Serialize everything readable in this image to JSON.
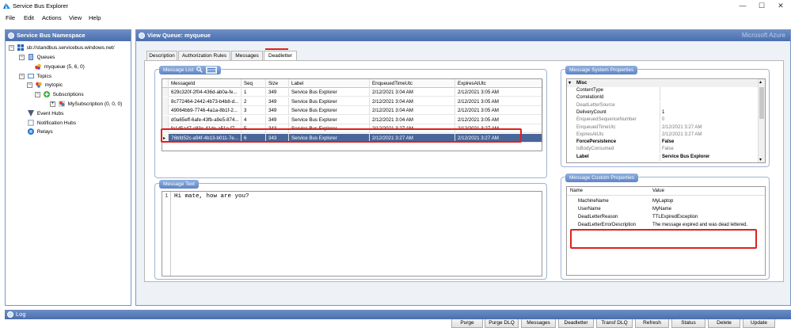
{
  "window": {
    "title": "Service Bus Explorer",
    "brand": "Microsoft Azure"
  },
  "menu": [
    "File",
    "Edit",
    "Actions",
    "View",
    "Help"
  ],
  "left": {
    "header": "Service Bus Namespace",
    "tree": {
      "root": "sb://standbus.servicebus.windows.net/",
      "queues": "Queues",
      "queue_item": "myqueue (5, 6, 0)",
      "topics": "Topics",
      "topic_item": "mytopic",
      "subscriptions": "Subscriptions",
      "subscription_item": "MySubscription (0, 0, 0)",
      "event_hubs": "Event Hubs",
      "notification_hubs": "Notification Hubs",
      "relays": "Relays"
    }
  },
  "right": {
    "header": "View Queue: myqueue",
    "tabs": [
      "Description",
      "Authorization Rules",
      "Messages",
      "Deadletter"
    ],
    "active_tab": "Deadletter",
    "message_list": {
      "title": "Message List",
      "columns": [
        "MessageId",
        "Seq",
        "Size",
        "Label",
        "EnqueuedTimeUtc",
        "ExpiresAtUtc"
      ],
      "rows": [
        [
          "629c320f-2f04-436d-ab0a-fe...",
          "1",
          "349",
          "Service Bus Explorer",
          "2/12/2021 3:04 AM",
          "2/12/2021 3:05 AM"
        ],
        [
          "8c772464-2442-4b73-b4b8-d...",
          "2",
          "349",
          "Service Bus Explorer",
          "2/12/2021 3:04 AM",
          "2/12/2021 3:05 AM"
        ],
        [
          "49064bb9-7746-4a1a-8b1f-2...",
          "3",
          "349",
          "Service Bus Explorer",
          "2/12/2021 3:04 AM",
          "2/12/2021 3:05 AM"
        ],
        [
          "d0a65eff-6afe-43fb-a9e5-874...",
          "4",
          "349",
          "Service Bus Explorer",
          "2/12/2021 3:04 AM",
          "2/12/2021 3:05 AM"
        ],
        [
          "fe145a47-c83e-41de-a51e-f7...",
          "5",
          "343",
          "Service Bus Explorer",
          "2/12/2021 3:27 AM",
          "2/12/2021 3:27 AM"
        ],
        [
          "76bfd52c-a94f-4b13-b011-7e...",
          "6",
          "343",
          "Service Bus Explorer",
          "2/12/2021 3:27 AM",
          "2/12/2021 3:27 AM"
        ]
      ],
      "selected_row": 5
    },
    "message_text": {
      "title": "Message Text",
      "line_number": "1",
      "content": "Hi mate, how are you?"
    },
    "system_props": {
      "title": "Message System Properties",
      "category": "Misc",
      "rows": [
        [
          "ContentType",
          ""
        ],
        [
          "CorrelationId",
          ""
        ],
        [
          "DeadLetterSource",
          ""
        ],
        [
          "DeliveryCount",
          "1"
        ],
        [
          "EnqueuedSequenceNumber",
          "0"
        ],
        [
          "EnqueuedTimeUtc",
          "2/12/2021 3:27 AM"
        ],
        [
          "ExpiresAtUtc",
          "2/12/2021 3:27 AM"
        ],
        [
          "ForcePersistence",
          "False"
        ],
        [
          "IsBodyConsumed",
          "False"
        ],
        [
          "Label",
          "Service Bus Explorer"
        ]
      ]
    },
    "custom_props": {
      "title": "Message Custom Properties",
      "columns": [
        "Name",
        "Value"
      ],
      "rows": [
        [
          "MachineName",
          "MyLaptop"
        ],
        [
          "UserName",
          "MyName"
        ],
        [
          "DeadLetterReason",
          "TTLExpiredException"
        ],
        [
          "DeadLetterErrorDescription",
          "The message expired and was dead lettered."
        ]
      ]
    },
    "buttons": [
      "Purge",
      "Purge DLQ",
      "Messages",
      "Deadletter",
      "Transf DLQ",
      "Refresh",
      "Status",
      "Delete",
      "Update"
    ]
  },
  "log": {
    "title": "Log"
  },
  "colors": {
    "header": "#4a6fae",
    "selection": "#49669a",
    "highlight": "#e0201c"
  }
}
